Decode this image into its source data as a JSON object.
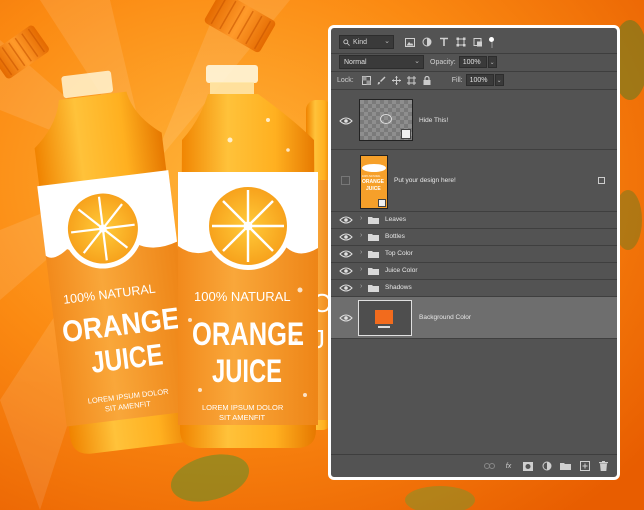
{
  "scene": {
    "bottles": [
      {
        "natural": "100% NATURAL",
        "line1": "ORANGE",
        "line2": "JUICE",
        "lorem1": "LOREM IPSUM DOLOR",
        "lorem2": "SIT AMENFIT"
      },
      {
        "natural": "100% NATURAL",
        "line1": "ORANGE",
        "line2": "JUICE",
        "lorem1": "LOREM IPSUM DOLOR",
        "lorem2": "SIT AMENFIT"
      }
    ],
    "colors": {
      "orange_bright": "#ffab2b",
      "orange_deep": "#f26b00",
      "label_orange": "#f7a12a"
    }
  },
  "layers_panel": {
    "filter": {
      "kind_label": "Kind",
      "icons": [
        "image-filter-icon",
        "adjustment-filter-icon",
        "type-filter-icon",
        "shape-filter-icon",
        "smart-object-filter-icon"
      ]
    },
    "blend_mode": "Normal",
    "opacity_label": "Opacity:",
    "opacity_value": "100%",
    "lock_label": "Lock:",
    "lock_icons": [
      "lock-transparent-icon",
      "lock-paint-icon",
      "lock-position-icon",
      "lock-artboard-icon",
      "lock-all-icon"
    ],
    "fill_label": "Fill:",
    "fill_value": "100%",
    "layers": [
      {
        "name": "Hide This!",
        "visible": true,
        "type": "smart"
      },
      {
        "name": "Put your design here!",
        "visible": false,
        "type": "smart",
        "thumb_text": [
          "100% NATURAL",
          "ORANGE",
          "JUICE"
        ]
      },
      {
        "name": "Leaves",
        "visible": true,
        "type": "group"
      },
      {
        "name": "Bottles",
        "visible": true,
        "type": "group"
      },
      {
        "name": "Top Color",
        "visible": true,
        "type": "group"
      },
      {
        "name": "Juice Color",
        "visible": true,
        "type": "group"
      },
      {
        "name": "Shadows",
        "visible": true,
        "type": "group"
      },
      {
        "name": "Background Color",
        "visible": true,
        "type": "smart",
        "selected": true,
        "swatch": "#f26b1d"
      }
    ],
    "bottom_icons": [
      "link-layers-icon",
      "fx-icon",
      "layer-mask-icon",
      "adjustment-layer-icon",
      "new-group-icon",
      "new-layer-icon",
      "trash-icon"
    ],
    "fx_label": "fx"
  }
}
